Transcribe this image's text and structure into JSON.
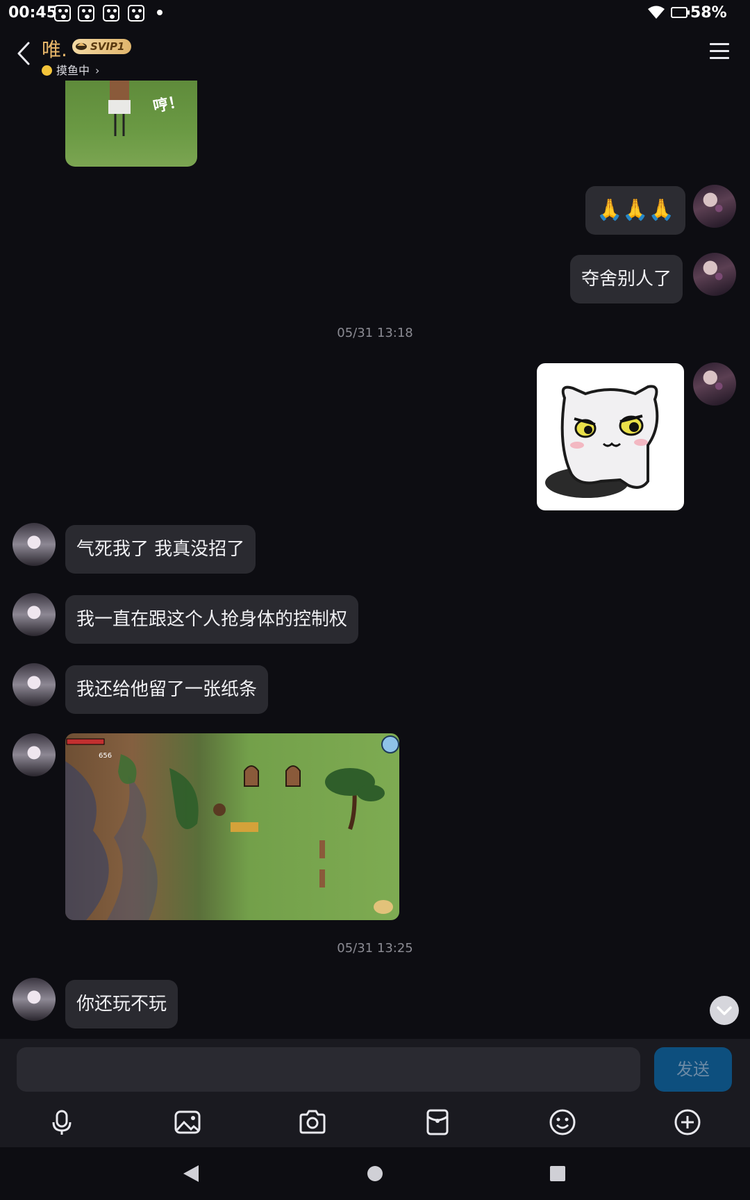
{
  "status_bar": {
    "time": "00:45",
    "battery": "58%"
  },
  "header": {
    "contact_name": "唯.",
    "badge": "SVIP1",
    "status": "摸鱼中"
  },
  "messages": {
    "top_image_text": "哼！",
    "me_1": "🙏🙏🙏",
    "me_2": "夺舍别人了",
    "timestamp_1": "05/31 13:18",
    "other_1": "气死我了 我真没招了",
    "other_2": "我一直在跟这个人抢身体的控制权",
    "other_3": "我还给他留了一张纸条",
    "game_score": "656",
    "timestamp_2": "05/31 13:25",
    "other_4": "你还玩不玩"
  },
  "input": {
    "placeholder": "",
    "send_label": "发送"
  },
  "toolbar_icons": [
    "microphone-icon",
    "image-icon",
    "camera-icon",
    "red-packet-icon",
    "emoji-icon",
    "plus-icon"
  ],
  "colors": {
    "background": "#0d0d12",
    "bubble": "#2a2a30",
    "send_button": "#0d4f7e",
    "vip_name": "#e8b76a"
  }
}
